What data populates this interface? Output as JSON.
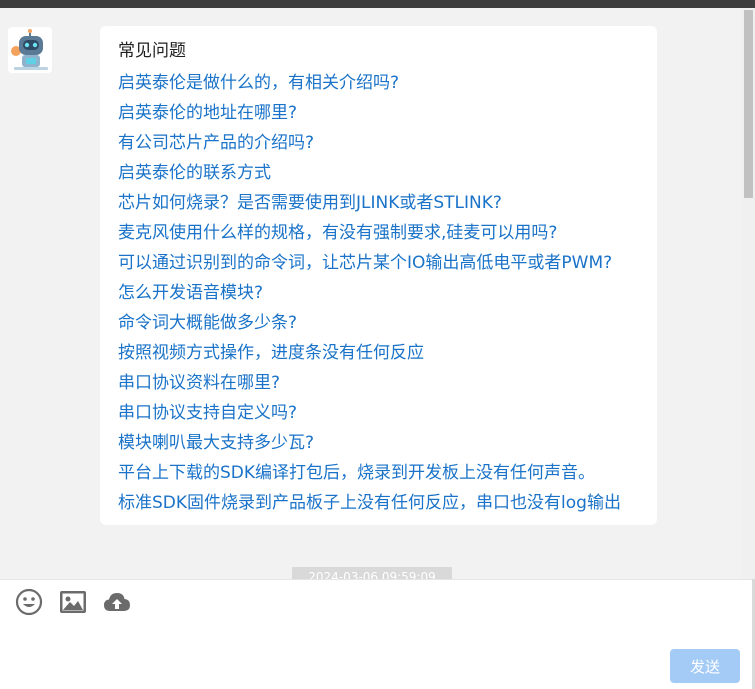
{
  "chat": {
    "bubble_title": "常见问题",
    "faq": [
      "启英泰伦是做什么的，有相关介绍吗?",
      "启英泰伦的地址在哪里?",
      "有公司芯片产品的介绍吗?",
      "启英泰伦的联系方式",
      "芯片如何烧录？是否需要使用到JLINK或者STLINK?",
      "麦克风使用什么样的规格，有没有强制要求,硅麦可以用吗?",
      "可以通过识别到的命令词，让芯片某个IO输出高低电平或者PWM?",
      "怎么开发语音模块?",
      "命令词大概能做多少条?",
      "按照视频方式操作，进度条没有任何反应",
      "串口协议资料在哪里?",
      "串口协议支持自定义吗?",
      "模块喇叭最大支持多少瓦?",
      "平台上下载的SDK编译打包后，烧录到开发板上没有任何声音。",
      "标准SDK固件烧录到产品板子上没有任何反应，串口也没有log输出"
    ],
    "timestamp": "2024-03-06 09:59:09"
  },
  "input": {
    "send_label": "发送",
    "tools": [
      "smiley-icon",
      "image-icon",
      "cloud-upload-icon"
    ]
  },
  "colors": {
    "link": "#1a73c9",
    "send_button": "#a4cbf6",
    "background": "#f2f2f2"
  }
}
